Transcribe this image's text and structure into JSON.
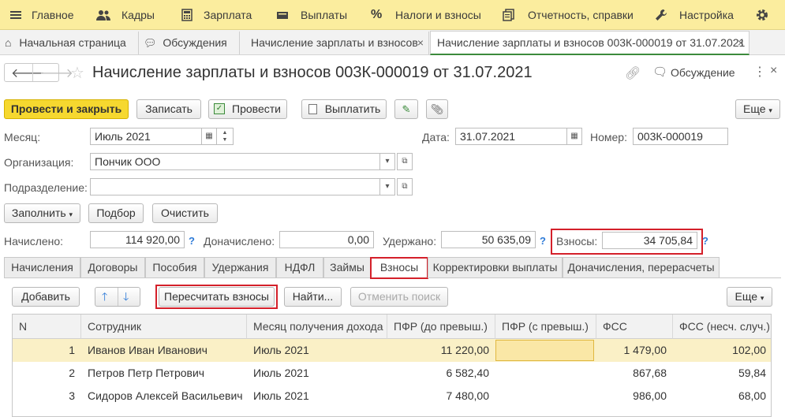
{
  "menu": {
    "items": [
      {
        "label": "Главное",
        "icon": "hamburger-icon"
      },
      {
        "label": "Кадры",
        "icon": "people-icon"
      },
      {
        "label": "Зарплата",
        "icon": "calculator-icon"
      },
      {
        "label": "Выплаты",
        "icon": "wallet-icon"
      },
      {
        "label": "Налоги и взносы",
        "icon": "percent-icon"
      },
      {
        "label": "Отчетность, справки",
        "icon": "reports-icon"
      },
      {
        "label": "Настройка",
        "icon": "wrench-icon"
      }
    ],
    "settings_icon": "gear-icon"
  },
  "tabs": {
    "home": "Начальная страница",
    "discussions": "Обсуждения",
    "tab3": "Начисление зарплаты и взносов",
    "tab4": "Начисление зарплаты и взносов 003К-000019 от 31.07.2021",
    "close": "×"
  },
  "header": {
    "title": "Начисление зарплаты и взносов 003К-000019 от 31.07.2021",
    "discussion": "Обсуждение"
  },
  "toolbar": {
    "post_close": "Провести и закрыть",
    "save": "Записать",
    "post": "Провести",
    "pay": "Выплатить",
    "more": "Еще"
  },
  "form": {
    "month_label": "Месяц:",
    "month_value": "Июль 2021",
    "date_label": "Дата:",
    "date_value": "31.07.2021",
    "number_label": "Номер:",
    "number_value": "003К-000019",
    "org_label": "Организация:",
    "org_value": "Пончик ООО",
    "dept_label": "Подразделение:",
    "dept_value": ""
  },
  "actions": {
    "fill": "Заполнить",
    "pick": "Подбор",
    "clear": "Очистить"
  },
  "totals": {
    "accrued_label": "Начислено:",
    "accrued_value": "114 920,00",
    "extra_label": "Доначислено:",
    "extra_value": "0,00",
    "withheld_label": "Удержано:",
    "withheld_value": "50 635,09",
    "contrib_label": "Взносы:",
    "contrib_value": "34 705,84",
    "help": "?"
  },
  "subtabs": [
    "Начисления",
    "Договоры",
    "Пособия",
    "Удержания",
    "НДФЛ",
    "Займы",
    "Взносы",
    "Корректировки выплаты",
    "Доначисления, перерасчеты"
  ],
  "table_toolbar": {
    "add": "Добавить",
    "recalc": "Пересчитать взносы",
    "find": "Найти...",
    "cancel_search": "Отменить поиск",
    "more": "Еще"
  },
  "table": {
    "columns": [
      "N",
      "Сотрудник",
      "Месяц получения дохода",
      "ПФР (до превыш.)",
      "ПФР (с превыш.)",
      "ФСС",
      "ФСС (несч. случ.)"
    ],
    "rows": [
      {
        "n": "1",
        "employee": "Иванов Иван Иванович",
        "month": "Июль 2021",
        "pfr": "11 220,00",
        "pfr_over": "",
        "fss": "1 479,00",
        "fss_ns": "102,00"
      },
      {
        "n": "2",
        "employee": "Петров Петр Петрович",
        "month": "Июль 2021",
        "pfr": "6 582,40",
        "pfr_over": "",
        "fss": "867,68",
        "fss_ns": "59,84"
      },
      {
        "n": "3",
        "employee": "Сидоров Алексей Васильевич",
        "month": "Июль 2021",
        "pfr": "7 480,00",
        "pfr_over": "",
        "fss": "986,00",
        "fss_ns": "68,00"
      }
    ]
  },
  "colors": {
    "menu_bg": "#fbed9e",
    "primary_button": "#f6d82f",
    "highlight": "#d4202a",
    "selected_row": "#faf0c6"
  }
}
